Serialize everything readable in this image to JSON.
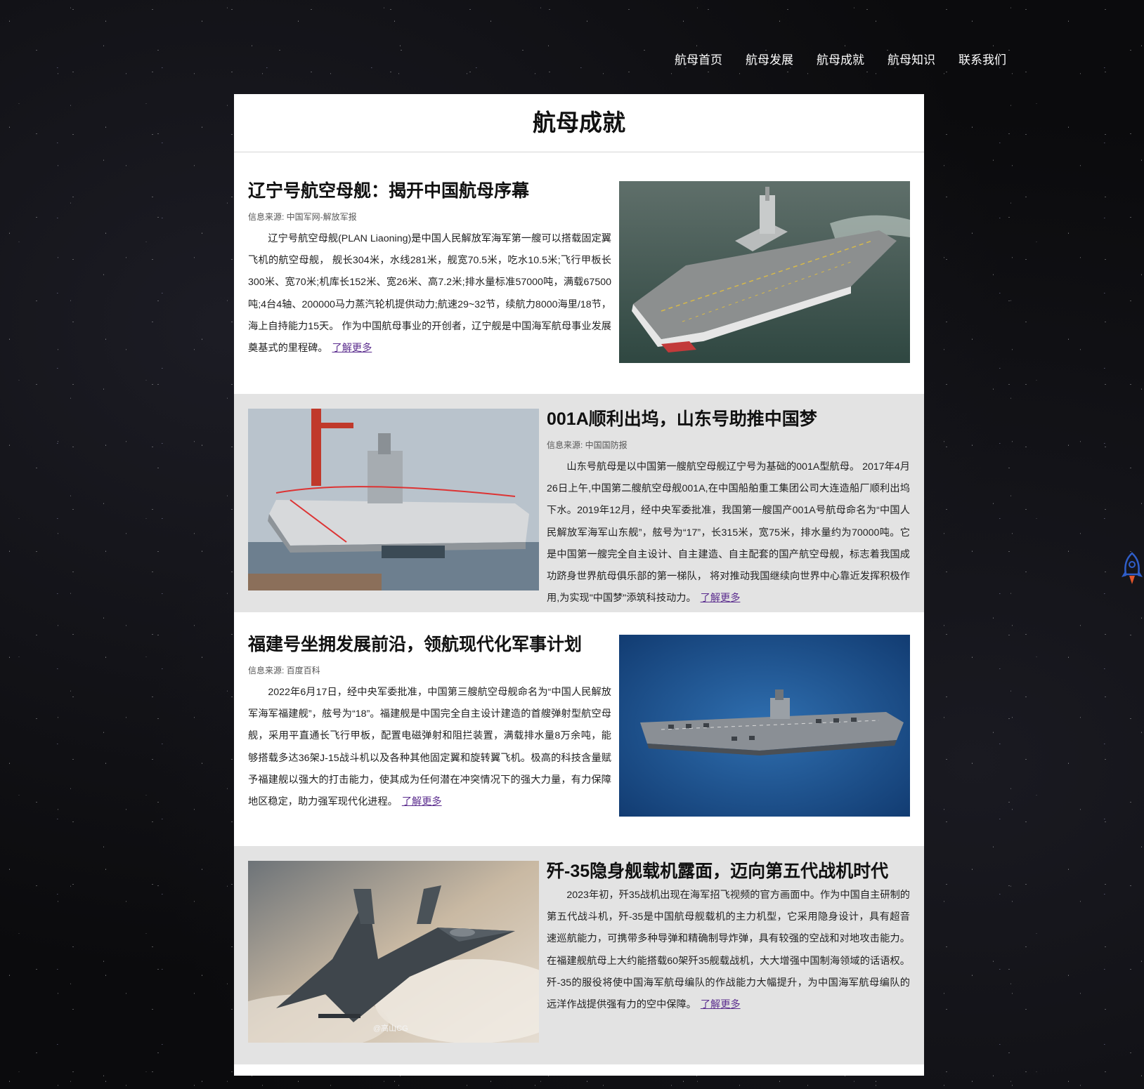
{
  "nav": {
    "items": [
      {
        "label": "航母首页"
      },
      {
        "label": "航母发展"
      },
      {
        "label": "航母成就"
      },
      {
        "label": "航母知识"
      },
      {
        "label": "联系我们"
      }
    ]
  },
  "page": {
    "title": "航母成就"
  },
  "articles": [
    {
      "title": "辽宁号航空母舰：揭开中国航母序幕",
      "source": "信息来源: 中国军网-解放军报",
      "body": "辽宁号航空母舰(PLAN Liaoning)是中国人民解放军海军第一艘可以搭载固定翼飞机的航空母舰， 舰长304米，水线281米，舰宽70.5米，吃水10.5米;飞行甲板长300米、宽70米;机库长152米、宽26米、高7.2米;排水量标准57000吨，满载67500吨;4台4轴、200000马力蒸汽轮机提供动力;航速29~32节，续航力8000海里/18节，海上自持能力15天。 作为中国航母事业的开创者，辽宁舰是中国海军航母事业发展奠基式的里程碑。",
      "more": "了解更多",
      "image_icon": "aircraft-carrier-liaoning-photo"
    },
    {
      "title": "001A顺利出坞，山东号助推中国梦",
      "source": "信息来源: 中国国防报",
      "body": "山东号航母是以中国第一艘航空母舰辽宁号为基础的001A型航母。 2017年4月26日上午,中国第二艘航空母舰001A,在中国船舶重工集团公司大连造船厂顺利出坞下水。2019年12月，经中央军委批准，我国第一艘国产001A号航母命名为“中国人民解放军海军山东舰”，舷号为“17”，长315米，宽75米，排水量约为70000吨。它 是中国第一艘完全自主设计、自主建造、自主配套的国产航空母舰，标志着我国成功跻身世界航母俱乐部的第一梯队， 将对推动我国继续向世界中心靠近发挥积极作用,为实现\"中国梦\"添筑科技动力。",
      "more": "了解更多",
      "image_icon": "aircraft-carrier-shandong-photo"
    },
    {
      "title": "福建号坐拥发展前沿，领航现代化军事计划",
      "source": "信息来源: 百度百科",
      "body": "2022年6月17日，经中央军委批准，中国第三艘航空母舰命名为“中国人民解放军海军福建舰”，舷号为“18”。福建舰是中国完全自主设计建造的首艘弹射型航空母舰，采用平直通长飞行甲板，配置电磁弹射和阻拦装置，满载排水量8万余吨，能够搭载多达36架J-15战斗机以及各种其他固定翼和旋转翼飞机。极高的科技含量赋予福建舰以强大的打击能力，使其成为任何潜在冲突情况下的强大力量，有力保障地区稳定，助力强军现代化进程。",
      "more": "了解更多",
      "image_icon": "aircraft-carrier-fujian-photo"
    },
    {
      "title": "歼-35隐身舰载机露面，迈向第五代战机时代",
      "source": "",
      "body": "2023年初，歼35战机出现在海军招飞视频的官方画面中。作为中国自主研制的第五代战斗机，歼-35是中国航母舰载机的主力机型，它采用隐身设计，具有超音速巡航能力，可携带多种导弹和精确制导炸弹，具有较强的空战和对地攻击能力。在福建舰航母上大约能搭载60架歼35舰载战机，大大增强中国制海领域的话语权。歼-35的服役将使中国海军航母编队的作战能力大幅提升，为中国海军航母编队的远洋作战提供强有力的空中保障。",
      "more": "了解更多",
      "image_icon": "j35-fighter-jet-photo",
      "image_watermark": "@高山CG"
    }
  ],
  "back_to_top": {
    "icon": "rocket-icon"
  },
  "colors": {
    "background": "#0b0b0d",
    "card": "#ffffff",
    "alt_row": "#e3e3e3",
    "link": "#5b2d8e"
  }
}
